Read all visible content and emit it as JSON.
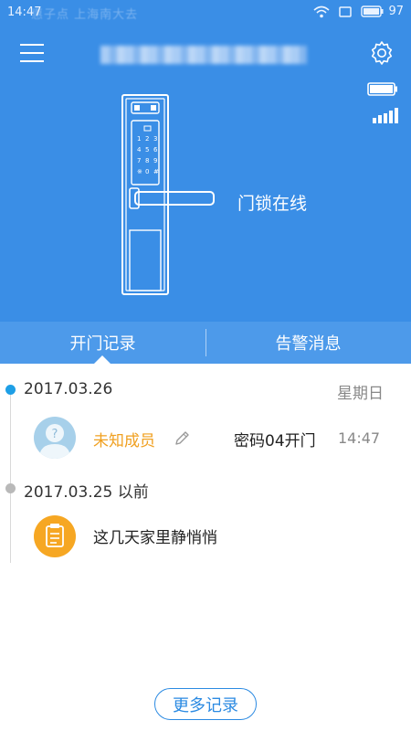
{
  "status_bar": {
    "time": "14:47",
    "notification_text": "惠子点 上海南大去",
    "battery_level": "97"
  },
  "header": {
    "title": ""
  },
  "lock": {
    "status_text": "门锁在线",
    "battery_fill_fraction": 1.0,
    "signal_bars": 5,
    "keypad_keys": [
      "1",
      "2",
      "3",
      "4",
      "5",
      "6",
      "7",
      "8",
      "9",
      "※",
      "0",
      "#"
    ]
  },
  "tabs": [
    {
      "label": "开门记录",
      "active": true
    },
    {
      "label": "告警消息",
      "active": false
    }
  ],
  "timeline": {
    "groups": [
      {
        "date": "2017.03.26",
        "weekday": "星期日",
        "entries": [
          {
            "member": "未知成员",
            "event": "密码04开门",
            "time": "14:47"
          }
        ]
      },
      {
        "date": "2017.03.25 以前",
        "message": "这几天家里静悄悄"
      }
    ]
  },
  "more_button_label": "更多记录",
  "colors": {
    "primary": "#3a8ee6",
    "tab_bar": "#4d9aea",
    "member_name": "#f0a020",
    "timeline_dot_active": "#1e9fe6",
    "clipboard": "#f6a723",
    "button_border": "#2b8ae2"
  }
}
